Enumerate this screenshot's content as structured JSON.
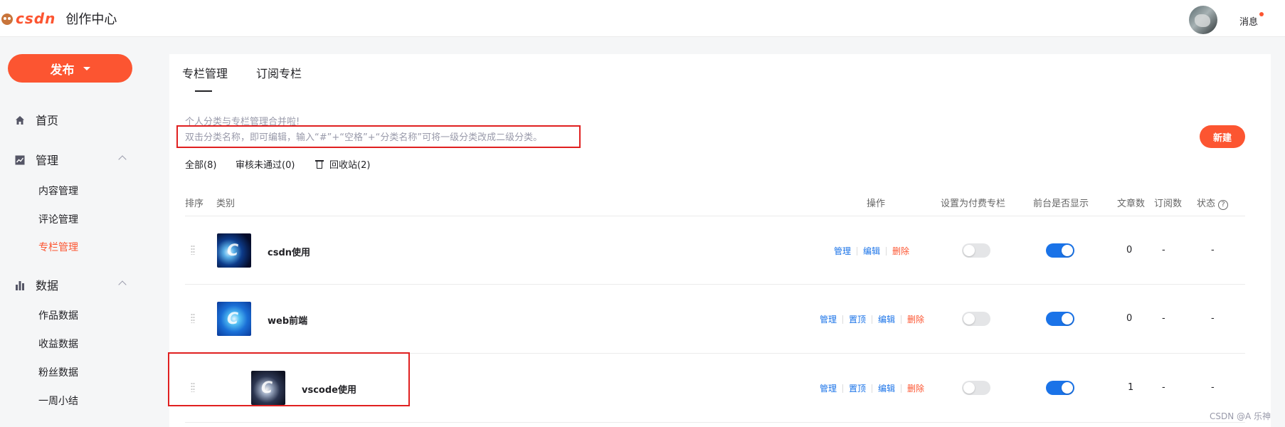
{
  "header": {
    "logo_text": "csdn",
    "app_title": "创作中心",
    "messages_label": "消息"
  },
  "sidebar": {
    "publish_label": "发布",
    "nav": [
      {
        "label": "首页",
        "icon": "home-icon"
      },
      {
        "label": "管理",
        "icon": "trend-chart-icon",
        "expanded": true,
        "children": [
          "内容管理",
          "评论管理",
          "专栏管理"
        ]
      },
      {
        "label": "数据",
        "icon": "bar-chart-icon",
        "expanded": true,
        "children": [
          "作品数据",
          "收益数据",
          "粉丝数据",
          "一周小结"
        ]
      }
    ],
    "active_item": "专栏管理"
  },
  "tabs": [
    "专栏管理",
    "订阅专栏"
  ],
  "active_tab": "专栏管理",
  "notice": {
    "line1": "个人分类与专栏管理合并啦!",
    "line2": "双击分类名称，即可编辑，输入“#”+“空格”+“分类名称”可将一级分类改成二级分类。"
  },
  "new_button_label": "新建",
  "filters": {
    "all": "全部(8)",
    "rejected": "审核未通过(0)",
    "recycle": "回收站(2)"
  },
  "table": {
    "headers": {
      "order": "排序",
      "category": "类别",
      "actions": "操作",
      "paid": "设置为付费专栏",
      "visible": "前台是否显示",
      "articles": "文章数",
      "subscriptions": "订阅数",
      "status": "状态"
    },
    "rows": [
      {
        "name": "csdn使用",
        "actions": [
          "管理",
          "编辑",
          "删除"
        ],
        "paid": false,
        "visible": true,
        "articles": "0",
        "subscriptions": "-",
        "status": "-",
        "level": 1
      },
      {
        "name": "web前端",
        "actions": [
          "管理",
          "置顶",
          "编辑",
          "删除"
        ],
        "paid": false,
        "visible": true,
        "articles": "0",
        "subscriptions": "-",
        "status": "-",
        "level": 1
      },
      {
        "name": "vscode使用",
        "actions": [
          "管理",
          "置顶",
          "编辑",
          "删除"
        ],
        "paid": false,
        "visible": true,
        "articles": "1",
        "subscriptions": "-",
        "status": "-",
        "level": 2
      }
    ]
  },
  "watermark": "CSDN @A 乐神",
  "colors": {
    "brand": "#fc5531",
    "link": "#1a73e8",
    "highlight_box": "#e02020"
  }
}
